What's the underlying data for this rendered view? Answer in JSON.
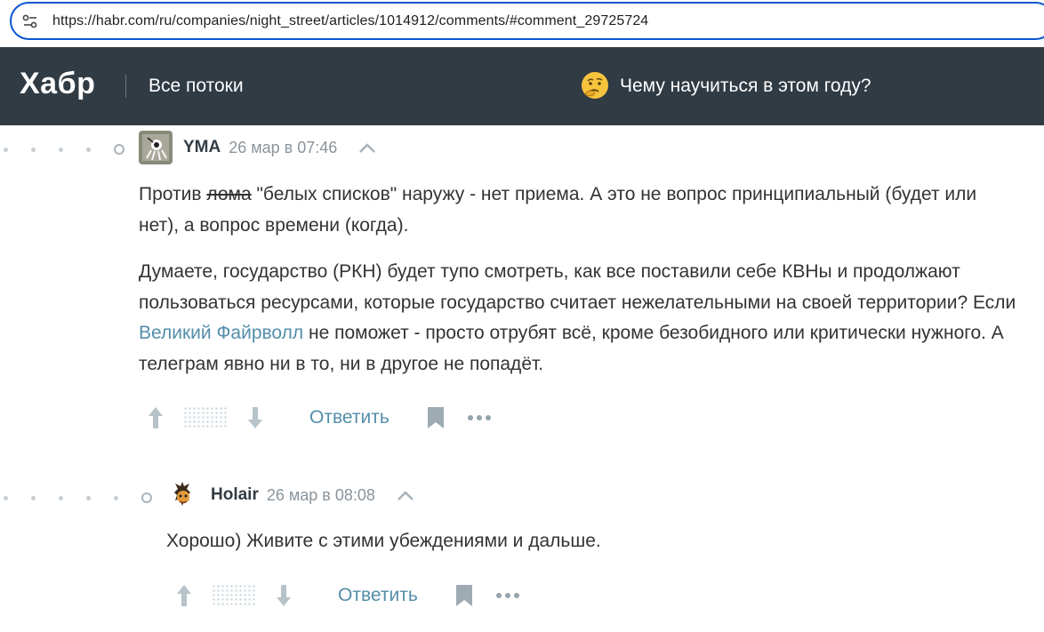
{
  "browser": {
    "url": "https://habr.com/ru/companies/night_street/articles/1014912/comments/#comment_29725724"
  },
  "header": {
    "logo": "Хабр",
    "flows_label": "Все потоки",
    "promo_text": "Чему научиться в этом году?",
    "background": "#303b44"
  },
  "comments": [
    {
      "author": "YMA",
      "time": "26 мар в 07:46",
      "paragraph1_before": "Против ",
      "paragraph1_strike": "лома",
      "paragraph1_after": " \"белых списков\" наружу - нет приема. А это не вопрос принципиальный (будет или нет), а вопрос времени (когда).",
      "paragraph2_before": "Думаете, государство (РКН) будет тупо смотреть, как все поставили себе КВНы и продолжают пользоваться ресурсами, которые государство считает нежелательными на своей территории? Если ",
      "paragraph2_link": "Великий Файрволл",
      "paragraph2_after": " не поможет - просто отрубят всё, кроме безобидного или критически нужного. А телеграм явно ни в то, ни в другое не попадёт.",
      "reply_label": "Ответить"
    },
    {
      "author": "Holair",
      "time": "26 мар в 08:08",
      "text": "Хорошо) Живите с этими убеждениями и дальше.",
      "reply_label": "Ответить"
    }
  ],
  "colors": {
    "link": "#548eaa",
    "accent_focus": "#0b57d0"
  }
}
